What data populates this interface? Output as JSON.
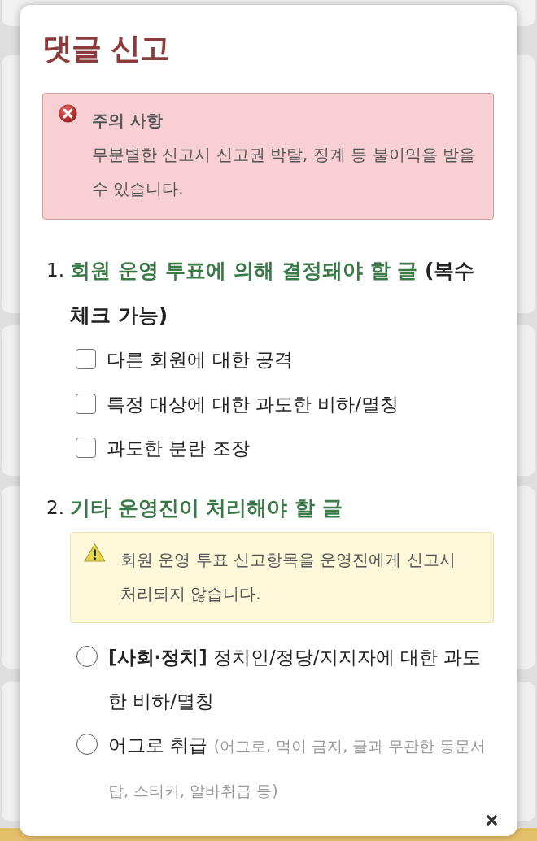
{
  "dialog": {
    "title": "댓글 신고"
  },
  "alert": {
    "kind": "error",
    "title": "주의 사항",
    "message": "무분별한 신고시 신고권 박탈, 징계 등 불이익을 받을 수 있습니다."
  },
  "sections": [
    {
      "number": "1.",
      "heading": "회원 운영 투표에 의해 결정돼야 할 글",
      "note": "(복수 체크 가능)",
      "options": [
        {
          "kind": "checkbox",
          "label": "다른 회원에 대한 공격",
          "checked": false
        },
        {
          "kind": "checkbox",
          "label": "특정 대상에 대한 과도한 비하/멸칭",
          "checked": false
        },
        {
          "kind": "checkbox",
          "label": "과도한 분란 조장",
          "checked": false
        }
      ]
    },
    {
      "number": "2.",
      "heading": "기타 운영진이 처리해야 할 글",
      "notice": {
        "kind": "warning",
        "message": "회원 운영 투표 신고항목을 운영진에게 신고시 처리되지 않습니다."
      },
      "options": [
        {
          "kind": "radio",
          "label": "**[사회·정치]** 정치인/정당/지지자에 대한 과도한 비하/멸칭",
          "selected": false
        },
        {
          "kind": "radio",
          "label": "어그로 취급",
          "hint": "(어그로, 먹이 금지, 글과 무관한 동문서답, 스티커, 알바취급 등)",
          "selected": false
        }
      ]
    }
  ]
}
